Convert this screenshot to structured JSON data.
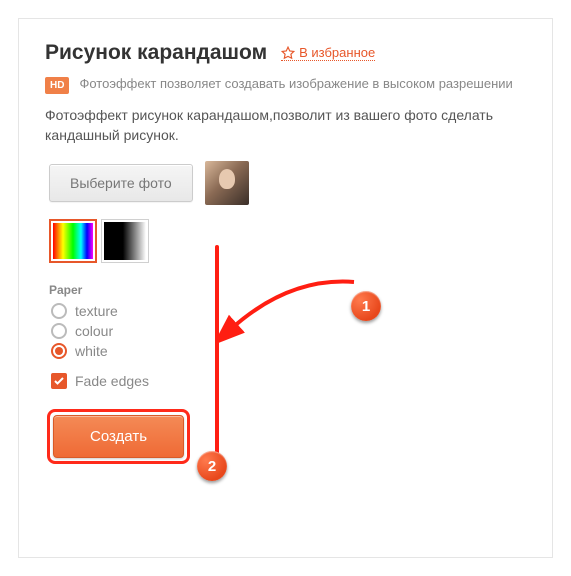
{
  "header": {
    "title": "Рисунок карандашом",
    "favorite_label": "В избранное"
  },
  "hd": {
    "badge": "HD",
    "text": "Фотоэффект позволяет создавать изображение в высоком разрешении"
  },
  "description": "Фотоэффект рисунок карандашом,позволит из вашего фото сделать кандашный рисунок.",
  "upload": {
    "button": "Выберите фото"
  },
  "paper": {
    "label": "Paper",
    "options": {
      "texture": "texture",
      "colour": "colour",
      "white": "white"
    }
  },
  "fade": {
    "label": "Fade edges"
  },
  "create": {
    "button": "Создать"
  },
  "annotations": {
    "step1": "1",
    "step2": "2"
  }
}
